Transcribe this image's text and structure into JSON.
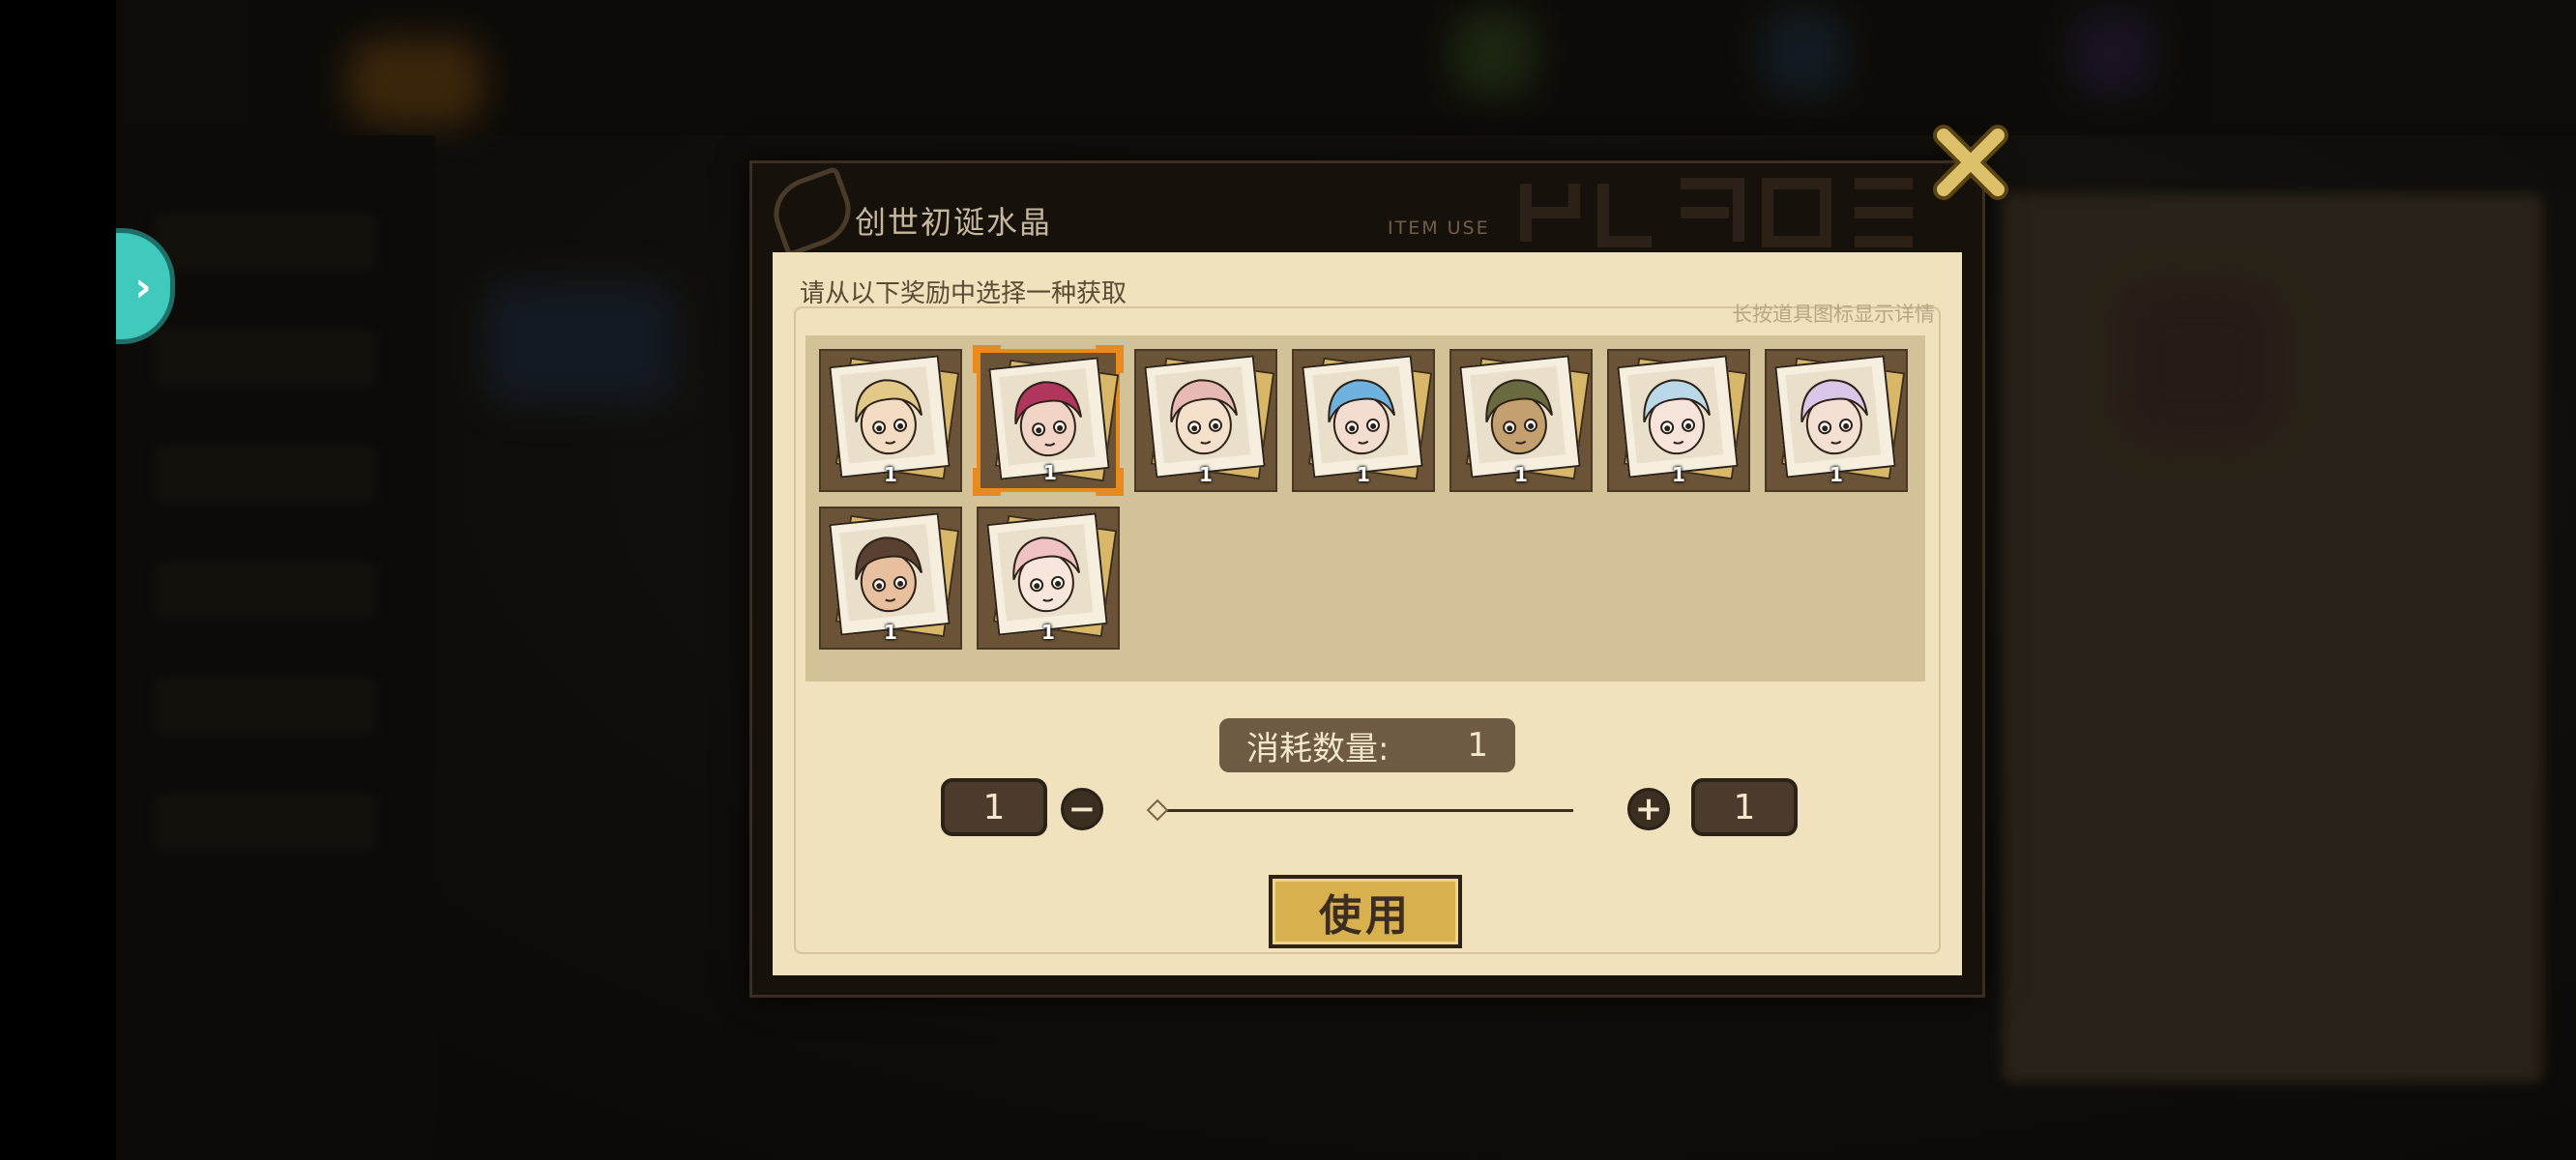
{
  "dialog": {
    "title": "创世初诞水晶",
    "subtitle": "ITEM USE",
    "instruction": "请从以下奖励中选择一种获取",
    "hint": "长按道具图标显示详情"
  },
  "rewards": [
    {
      "count": "1",
      "selected": false,
      "hair": "#e2c98a",
      "skin": "#f3dcc2"
    },
    {
      "count": "1",
      "selected": true,
      "hair": "#b0365e",
      "skin": "#f2d4c6"
    },
    {
      "count": "1",
      "selected": false,
      "hair": "#e7b9b4",
      "skin": "#f5e0cb"
    },
    {
      "count": "1",
      "selected": false,
      "hair": "#6fb2e0",
      "skin": "#f3dcd0"
    },
    {
      "count": "1",
      "selected": false,
      "hair": "#6a6a40",
      "skin": "#c4a070"
    },
    {
      "count": "1",
      "selected": false,
      "hair": "#b9d9e8",
      "skin": "#f6e4da"
    },
    {
      "count": "1",
      "selected": false,
      "hair": "#d9c6e8",
      "skin": "#f4e0d2"
    },
    {
      "count": "1",
      "selected": false,
      "hair": "#5a4030",
      "skin": "#e8c0a0"
    },
    {
      "count": "1",
      "selected": false,
      "hair": "#f0c2c2",
      "skin": "#f7e6dc"
    }
  ],
  "consume": {
    "label": "消耗数量:",
    "value": "1"
  },
  "quantity": {
    "current": "1",
    "max": "1",
    "minus": "−",
    "plus": "+",
    "slider_fraction": 0
  },
  "use_button": "使用",
  "colors": {
    "panel": "#f0e2bd",
    "accent_gold": "#d8b14e",
    "selected_border": "#e88a1e",
    "expand_tab": "#40c9bd"
  }
}
